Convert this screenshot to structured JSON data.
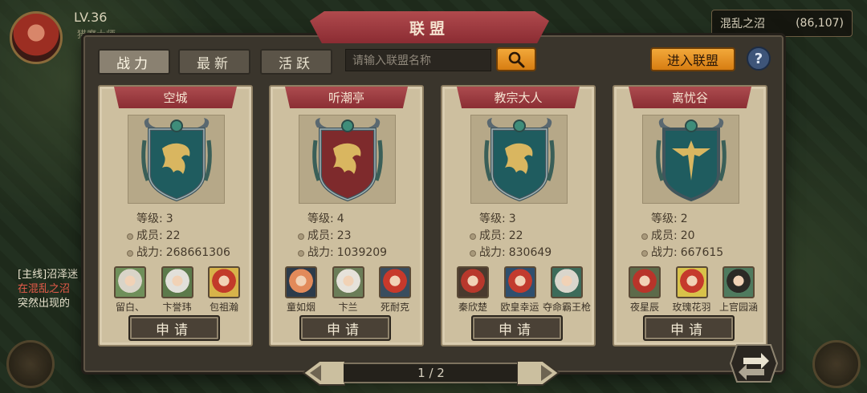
{
  "hud": {
    "level": "LV.36",
    "player_name": "猎魔大师",
    "quest_lines": [
      "[主线]沼泽迷",
      "在混乱之沼",
      "突然出现的"
    ],
    "location_name": "混乱之沼",
    "location_coords": "(86,107)"
  },
  "panel": {
    "title": "联盟",
    "tabs": [
      {
        "label": "战力",
        "active": true
      },
      {
        "label": "最新",
        "active": false
      },
      {
        "label": "活跃",
        "active": false
      }
    ],
    "search_placeholder": "请输入联盟名称",
    "join_label": "进入联盟",
    "help_label": "?"
  },
  "labels": {
    "level": "等级: ",
    "members": "成员: ",
    "power": "战力: "
  },
  "alliances": [
    {
      "name": "空城",
      "level": "3",
      "members": "22",
      "power": "268661306",
      "emblem": "dragon-emblem",
      "banner_color": "#1f5c5f",
      "roster": [
        {
          "name": "留白、"
        },
        {
          "name": "卞誉玮"
        },
        {
          "name": "包祖瀚"
        }
      ],
      "apply_label": "申请"
    },
    {
      "name": "听潮亭",
      "level": "4",
      "members": "23",
      "power": "1039209",
      "emblem": "dragon-emblem",
      "banner_color": "#7e2a2c",
      "roster": [
        {
          "name": "童如烟"
        },
        {
          "name": "卞兰"
        },
        {
          "name": "死耐克"
        }
      ],
      "apply_label": "申请"
    },
    {
      "name": "教宗大人",
      "level": "3",
      "members": "22",
      "power": "830649",
      "emblem": "dragon-emblem",
      "banner_color": "#1f5c5f",
      "roster": [
        {
          "name": "秦欣楚"
        },
        {
          "name": "欧皇幸运"
        },
        {
          "name": "夺命霸王枪"
        }
      ],
      "apply_label": "申请"
    },
    {
      "name": "离忧谷",
      "level": "2",
      "members": "20",
      "power": "667615",
      "emblem": "wing-emblem",
      "banner_color": "#1f5c5f",
      "roster": [
        {
          "name": "夜星辰"
        },
        {
          "name": "玫瑰花羽"
        },
        {
          "name": "上官园涵"
        }
      ],
      "apply_label": "申请"
    }
  ],
  "pagination": {
    "text": "1 / 2"
  },
  "colors": {
    "accent": "#e49221",
    "banner": "#9b3a3f",
    "card": "#cdbf9f"
  }
}
